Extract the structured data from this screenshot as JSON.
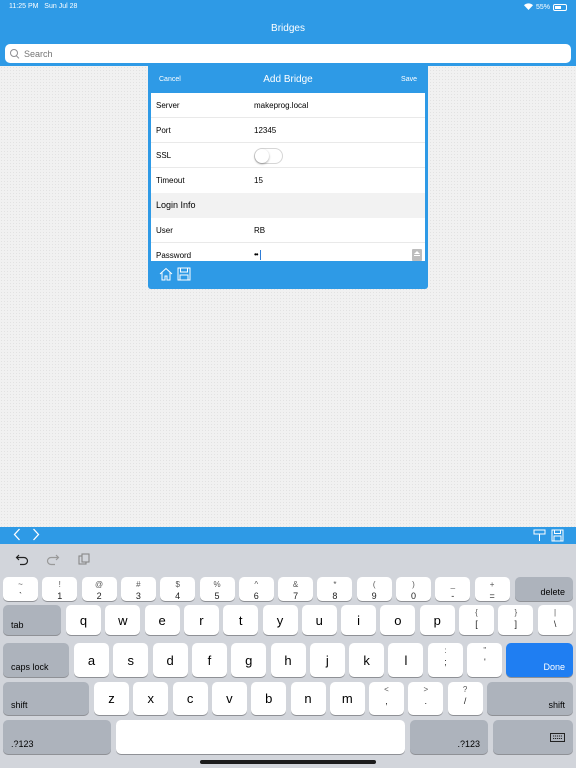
{
  "status": {
    "time": "11:25 PM",
    "date": "Sun Jul 28",
    "battery": "55%"
  },
  "nav": {
    "title": "Bridges"
  },
  "search": {
    "placeholder": "Search"
  },
  "modal": {
    "cancel": "Cancel",
    "title": "Add Bridge",
    "save": "Save",
    "rows": [
      {
        "label": "Server",
        "value": "makeprog.local"
      },
      {
        "label": "Port",
        "value": "12345"
      },
      {
        "label": "SSL",
        "value": "",
        "toggle_on": false
      },
      {
        "label": "Timeout",
        "value": "15"
      }
    ],
    "section": "Login Info",
    "user": {
      "label": "User",
      "value": "RB"
    },
    "password": {
      "label": "Password",
      "dots": "••"
    }
  },
  "colors": {
    "accent": "#2e9ae6",
    "done": "#1f7ef2",
    "keyboard_bg": "#d2d5db"
  },
  "keyboard": {
    "num_row": [
      {
        "top": "~",
        "bottom": "`"
      },
      {
        "top": "!",
        "bottom": "1"
      },
      {
        "top": "@",
        "bottom": "2"
      },
      {
        "top": "#",
        "bottom": "3"
      },
      {
        "top": "$",
        "bottom": "4"
      },
      {
        "top": "%",
        "bottom": "5"
      },
      {
        "top": "^",
        "bottom": "6"
      },
      {
        "top": "&",
        "bottom": "7"
      },
      {
        "top": "*",
        "bottom": "8"
      },
      {
        "top": "(",
        "bottom": "9"
      },
      {
        "top": ")",
        "bottom": "0"
      },
      {
        "top": "_",
        "bottom": "-"
      },
      {
        "top": "+",
        "bottom": "="
      }
    ],
    "delete": "delete",
    "tab": "tab",
    "row_q": [
      "q",
      "w",
      "e",
      "r",
      "t",
      "y",
      "u",
      "i",
      "o",
      "p"
    ],
    "row_q_sym": [
      {
        "top": "{",
        "bottom": "["
      },
      {
        "top": "}",
        "bottom": "]"
      },
      {
        "top": "|",
        "bottom": "\\"
      }
    ],
    "caps": "caps lock",
    "row_a": [
      "a",
      "s",
      "d",
      "f",
      "g",
      "h",
      "j",
      "k",
      "l"
    ],
    "row_a_sym": [
      {
        "top": ":",
        "bottom": ";"
      },
      {
        "top": "\"",
        "bottom": "'"
      }
    ],
    "done": "Done",
    "shift": "shift",
    "row_z": [
      "z",
      "x",
      "c",
      "v",
      "b",
      "n",
      "m"
    ],
    "row_z_sym": [
      {
        "top": "<",
        "bottom": ","
      },
      {
        "top": ">",
        "bottom": "."
      },
      {
        "top": "?",
        "bottom": "/"
      }
    ],
    "num_toggle": ".?123"
  }
}
